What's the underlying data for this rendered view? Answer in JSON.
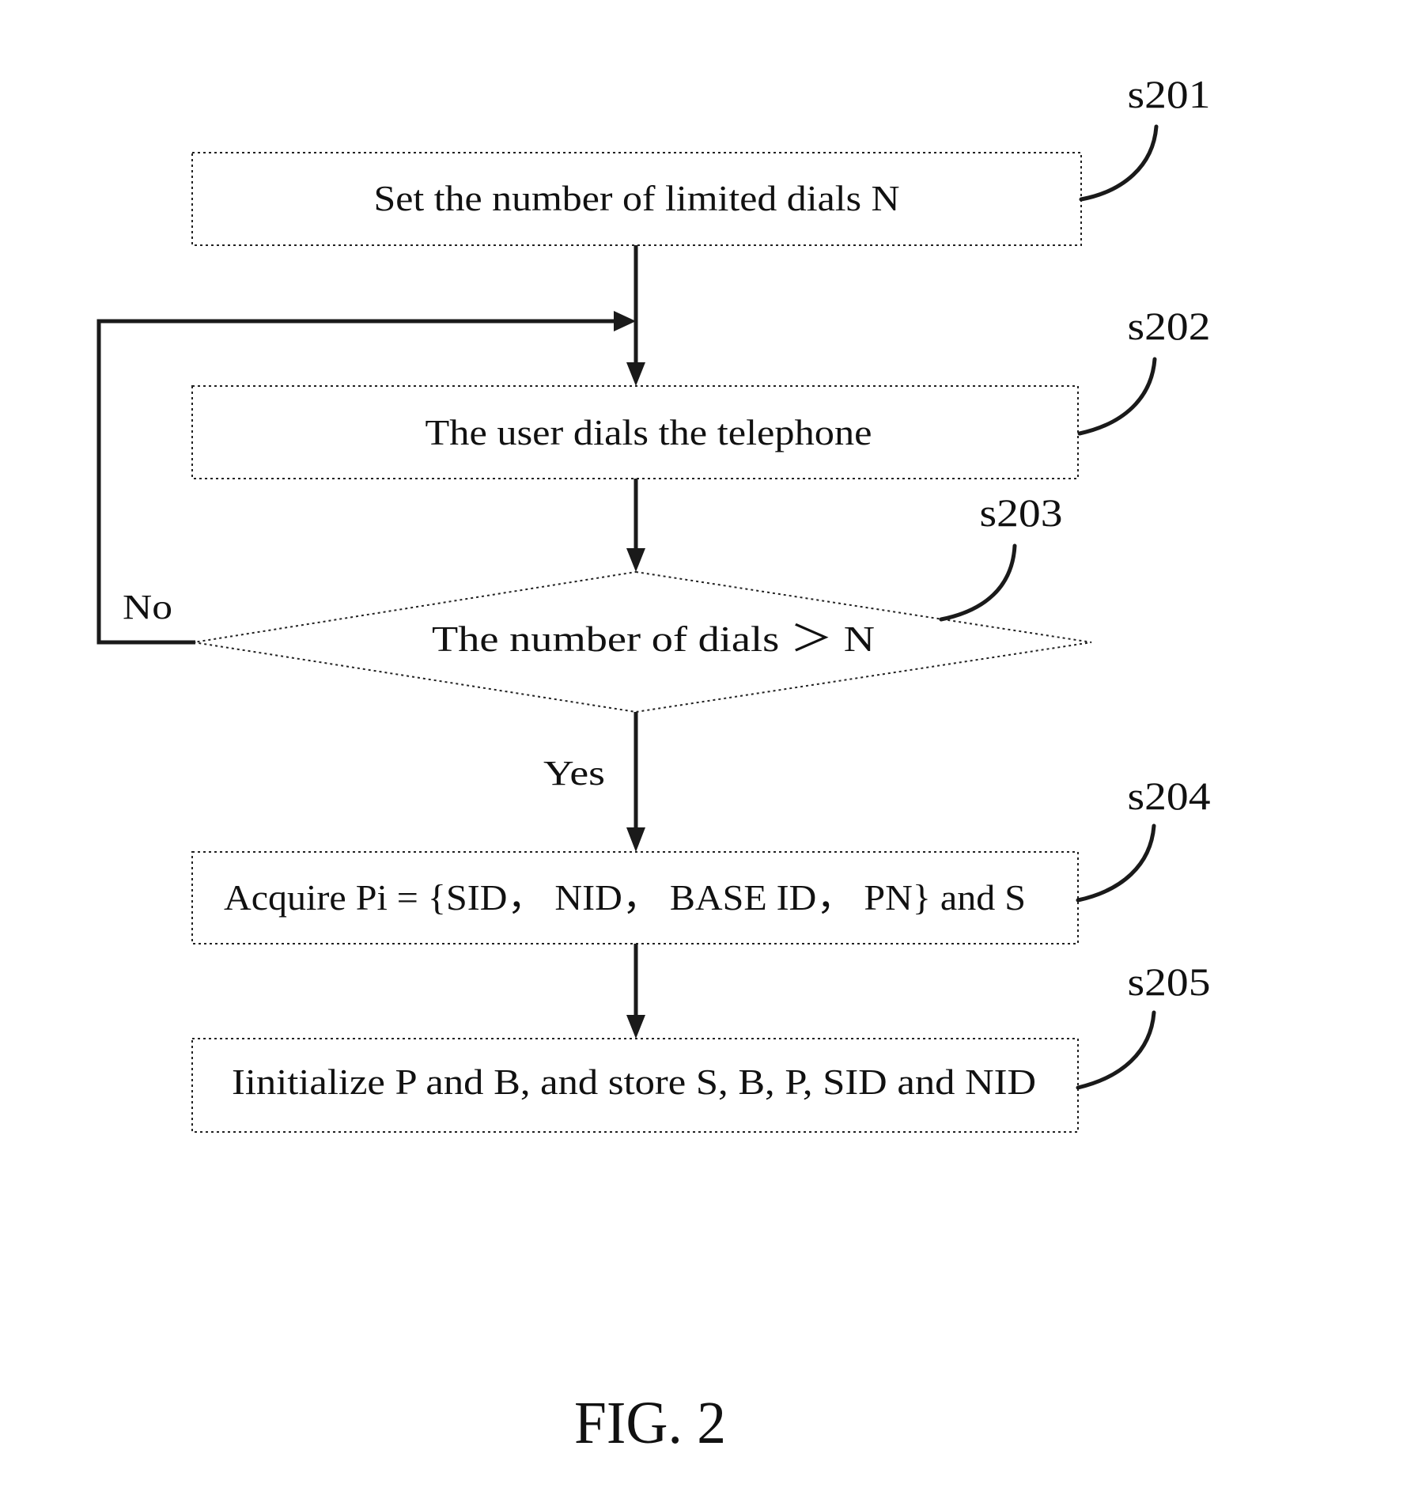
{
  "figure": {
    "caption": "FIG. 2",
    "steps": [
      {
        "id": "s201",
        "type": "process",
        "text": "Set the number of limited dials N"
      },
      {
        "id": "s202",
        "type": "process",
        "text": "The user dials the telephone"
      },
      {
        "id": "s203",
        "type": "decision",
        "text": "The number of dials ＞ N"
      },
      {
        "id": "s204",
        "type": "process",
        "text": "Acquire Pi = {SID， NID， BASE ID， PN} and S"
      },
      {
        "id": "s205",
        "type": "process",
        "text": "Iinitialize P and B, and store S, B, P, SID and NID"
      }
    ],
    "branches": {
      "no_label": "No",
      "yes_label": "Yes"
    },
    "edges": [
      {
        "from": "s201",
        "to": "s202"
      },
      {
        "from": "s202",
        "to": "s203"
      },
      {
        "from": "s203",
        "to": "s202",
        "label": "No"
      },
      {
        "from": "s203",
        "to": "s204",
        "label": "Yes"
      },
      {
        "from": "s204",
        "to": "s205"
      }
    ]
  }
}
